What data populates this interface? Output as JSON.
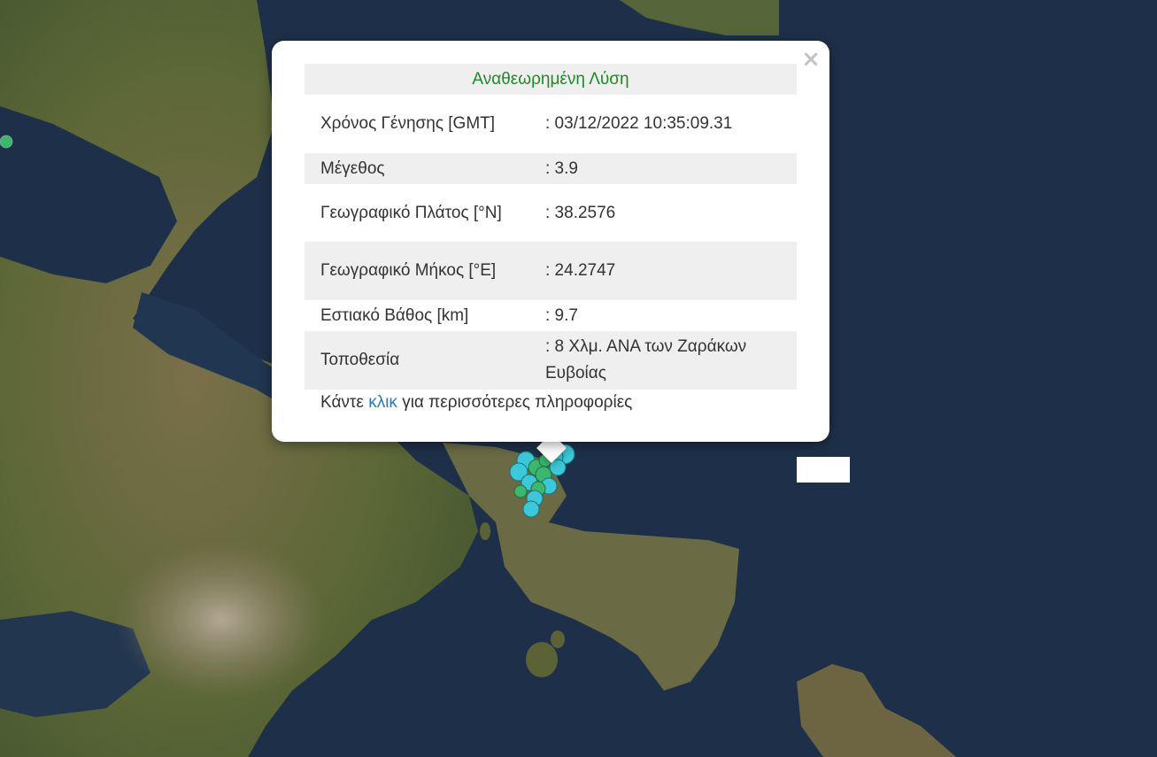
{
  "popup": {
    "title": "Αναθεωρημένη Λύση",
    "close_symbol": "×",
    "rows": [
      {
        "label": "Χρόνος Γένησης [GMT]",
        "value": ": 03/12/2022 10:35:09.31"
      },
      {
        "label": "Μέγεθος",
        "value": ": 3.9"
      },
      {
        "label": "Γεωγραφικό Πλάτος [°N]",
        "value": ": 38.2576"
      },
      {
        "label": "Γεωγραφικό Μήκος [°E]",
        "value": ": 24.2747"
      },
      {
        "label": "Εστιακό Βάθος [km]",
        "value": ": 9.7"
      },
      {
        "label": "Τοποθεσία",
        "value": ": 8 Χλμ. ΑΝΑ των Ζαράκων Ευβοίας"
      }
    ],
    "footer": {
      "before": "Κάντε ",
      "link": "κλικ",
      "after": " για περισσότερες πληροφορίες"
    }
  },
  "colors": {
    "sea": "#1d2f48",
    "land": "#5f6a3a",
    "title_green": "#22862a",
    "link_blue": "#2a7ab8",
    "marker_cyan": "#3cc8d8",
    "marker_green": "#3db66e"
  }
}
